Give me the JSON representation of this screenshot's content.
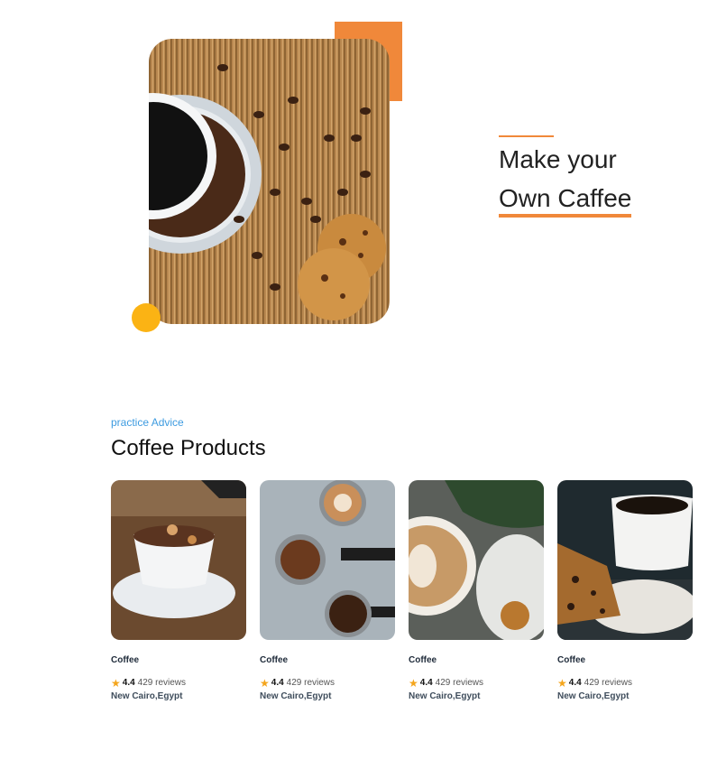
{
  "hero": {
    "heading_line1": "Make your",
    "heading_line2": "Own Caffee",
    "image": "coffee-cup-beans-cookies-photo"
  },
  "section": {
    "kicker": "practice Advice",
    "title": "Coffee Products"
  },
  "products": [
    {
      "name": "Coffee",
      "rating": "4.4",
      "reviews": "429 reviews",
      "location": "New Cairo,Egypt",
      "image": "mocha-cup-photo"
    },
    {
      "name": "Coffee",
      "rating": "4.4",
      "reviews": "429 reviews",
      "location": "New Cairo,Egypt",
      "image": "espresso-portafilters-photo"
    },
    {
      "name": "Coffee",
      "rating": "4.4",
      "reviews": "429 reviews",
      "location": "New Cairo,Egypt",
      "image": "latte-art-photo"
    },
    {
      "name": "Coffee",
      "rating": "4.4",
      "reviews": "429 reviews",
      "location": "New Cairo,Egypt",
      "image": "coffee-and-cake-photo"
    }
  ],
  "colors": {
    "accent_orange": "#f0883a",
    "accent_yellow": "#fbb314",
    "kicker_blue": "#3d9be0",
    "star": "#f4a51c"
  },
  "icons": {
    "rating": "star-icon"
  }
}
